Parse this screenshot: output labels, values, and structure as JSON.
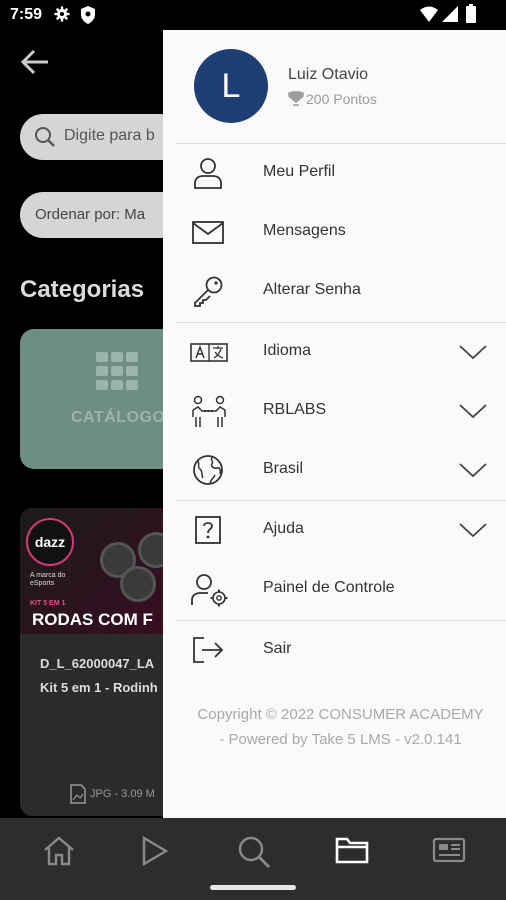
{
  "status_bar": {
    "time": "7:59"
  },
  "background": {
    "search_placeholder": "Digite para b",
    "order_label": "Ordenar por: Ma",
    "categories_title": "Categorias",
    "catalog_label": "CATÁLOGO",
    "card": {
      "brand": "dazz",
      "brand_tagline": "A marca do eSports",
      "kit_tag": "KIT 5 EM 1",
      "banner_title": "RODAS COM F",
      "title_line1": "D_L_62000047_LA",
      "title_line2": "Kit 5 em 1 - Rodinh",
      "file_info": "JPG - 3.09 M"
    }
  },
  "drawer": {
    "avatar_letter": "L",
    "user_name": "Luiz Otavio",
    "user_points": "200 Pontos",
    "menu": [
      {
        "label": "Meu Perfil",
        "icon": "user-icon"
      },
      {
        "label": "Mensagens",
        "icon": "mail-icon"
      },
      {
        "label": "Alterar Senha",
        "icon": "key-icon"
      },
      {
        "label": "Idioma",
        "icon": "translate-icon",
        "expandable": true
      },
      {
        "label": "RBLABS",
        "icon": "rblabs-icon",
        "expandable": true
      },
      {
        "label": "Brasil",
        "icon": "globe-icon",
        "expandable": true
      },
      {
        "label": "Ajuda",
        "icon": "help-icon",
        "expandable": true
      },
      {
        "label": "Painel de Controle",
        "icon": "user-settings-icon"
      },
      {
        "label": "Sair",
        "icon": "logout-icon"
      }
    ],
    "copyright_line1": "Copyright © 2022 CONSUMER ACADEMY",
    "copyright_line2": "- Powered by Take 5 LMS - v2.0.141"
  },
  "bottom_nav": [
    "home-icon",
    "play-icon",
    "search-icon",
    "folder-icon",
    "news-icon"
  ]
}
